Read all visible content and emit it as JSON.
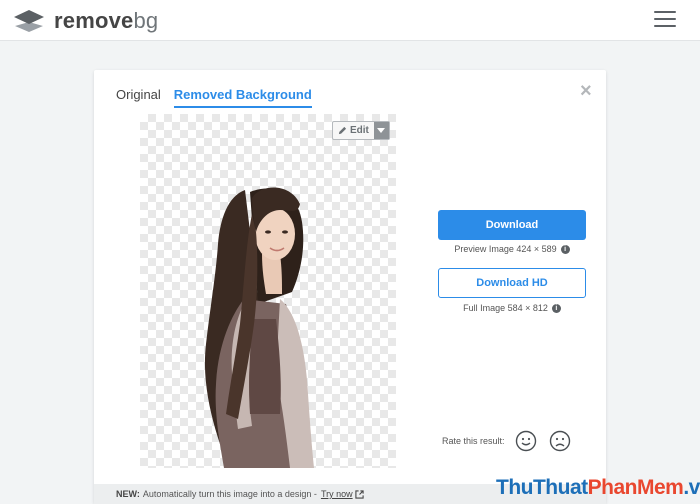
{
  "header": {
    "logo_word_bold": "remove",
    "logo_word_light": "bg",
    "menu_icon": "hamburger-icon"
  },
  "card": {
    "tabs": [
      {
        "label": "Original",
        "active": false
      },
      {
        "label": "Removed Background",
        "active": true
      }
    ],
    "close_icon": "close-icon",
    "edit": {
      "label": "Edit",
      "icon": "pencil-icon",
      "dropdown_icon": "caret-down-icon"
    },
    "download": {
      "label": "Download",
      "caption": "Preview Image 424 × 589"
    },
    "download_hd": {
      "label": "Download HD",
      "caption": "Full Image 584 × 812"
    },
    "rate": {
      "label": "Rate this result:",
      "icons": [
        "smile-icon",
        "frown-icon"
      ]
    },
    "banner": {
      "prefix": "NEW:",
      "text": "Automatically turn this image into a design -",
      "link": "Try now",
      "link_icon": "external-link-icon"
    }
  },
  "watermark": {
    "part1": "ThuThuat",
    "part2": "PhanMem",
    "part3": ".vn"
  },
  "colors": {
    "accent": "#2c8ce8",
    "background": "#f2f4f5",
    "watermark_blue": "#1d6fb8",
    "watermark_red": "#e9472f"
  }
}
